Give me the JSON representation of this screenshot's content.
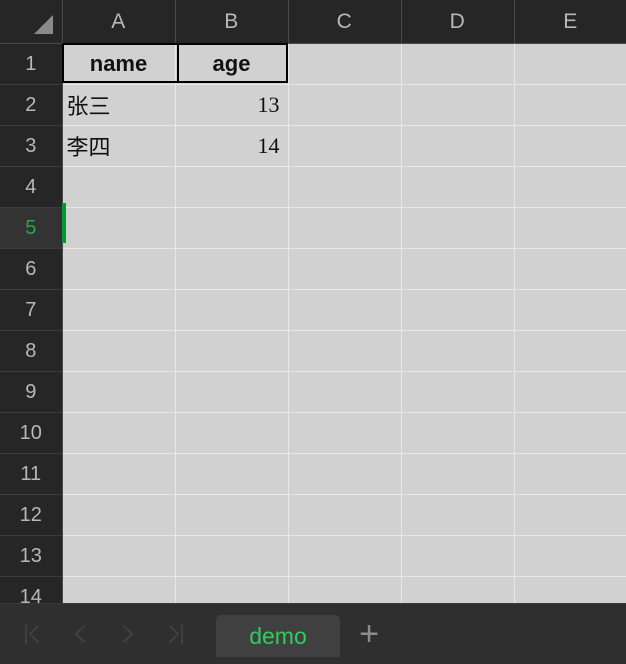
{
  "app": {
    "corner_icon": "select-all-triangle"
  },
  "grid": {
    "columns": [
      "A",
      "B",
      "C",
      "D",
      "E"
    ],
    "rows": [
      "1",
      "2",
      "3",
      "4",
      "5",
      "6",
      "7",
      "8",
      "9",
      "10",
      "11",
      "12",
      "13",
      "14"
    ],
    "active_row": "5",
    "active_cell": "A5",
    "selection_range": "A1:B1",
    "data": [
      {
        "row": "1",
        "A": "name",
        "B": "age",
        "C": "",
        "D": "",
        "E": "",
        "style": "header"
      },
      {
        "row": "2",
        "A": "张三",
        "B": "13",
        "C": "",
        "D": "",
        "E": "",
        "style": "data"
      },
      {
        "row": "3",
        "A": "李四",
        "B": "14",
        "C": "",
        "D": "",
        "E": "",
        "style": "data"
      },
      {
        "row": "4",
        "A": "",
        "B": "",
        "C": "",
        "D": "",
        "E": "",
        "style": "data"
      },
      {
        "row": "5",
        "A": "",
        "B": "",
        "C": "",
        "D": "",
        "E": "",
        "style": "data"
      },
      {
        "row": "6",
        "A": "",
        "B": "",
        "C": "",
        "D": "",
        "E": "",
        "style": "data"
      },
      {
        "row": "7",
        "A": "",
        "B": "",
        "C": "",
        "D": "",
        "E": "",
        "style": "data"
      },
      {
        "row": "8",
        "A": "",
        "B": "",
        "C": "",
        "D": "",
        "E": "",
        "style": "data"
      },
      {
        "row": "9",
        "A": "",
        "B": "",
        "C": "",
        "D": "",
        "E": "",
        "style": "data"
      },
      {
        "row": "10",
        "A": "",
        "B": "",
        "C": "",
        "D": "",
        "E": "",
        "style": "data"
      },
      {
        "row": "11",
        "A": "",
        "B": "",
        "C": "",
        "D": "",
        "E": "",
        "style": "data"
      },
      {
        "row": "12",
        "A": "",
        "B": "",
        "C": "",
        "D": "",
        "E": "",
        "style": "data"
      },
      {
        "row": "13",
        "A": "",
        "B": "",
        "C": "",
        "D": "",
        "E": "",
        "style": "data"
      },
      {
        "row": "14",
        "A": "",
        "B": "",
        "C": "",
        "D": "",
        "E": "",
        "style": "data"
      }
    ]
  },
  "tabbar": {
    "nav": [
      {
        "name": "first-sheet-icon",
        "label": "|<"
      },
      {
        "name": "previous-sheet-icon",
        "label": "<"
      },
      {
        "name": "next-sheet-icon",
        "label": ">"
      },
      {
        "name": "last-sheet-icon",
        "label": ">|"
      }
    ],
    "sheets": [
      {
        "label": "demo",
        "active": true
      }
    ],
    "add_label": "+"
  },
  "colors": {
    "accent_green": "#2fcc5f",
    "caret_green": "#009933",
    "header_bg": "#262626",
    "cell_bg": "#d1d1d1",
    "tabbar_bg": "#2f2f2f"
  }
}
